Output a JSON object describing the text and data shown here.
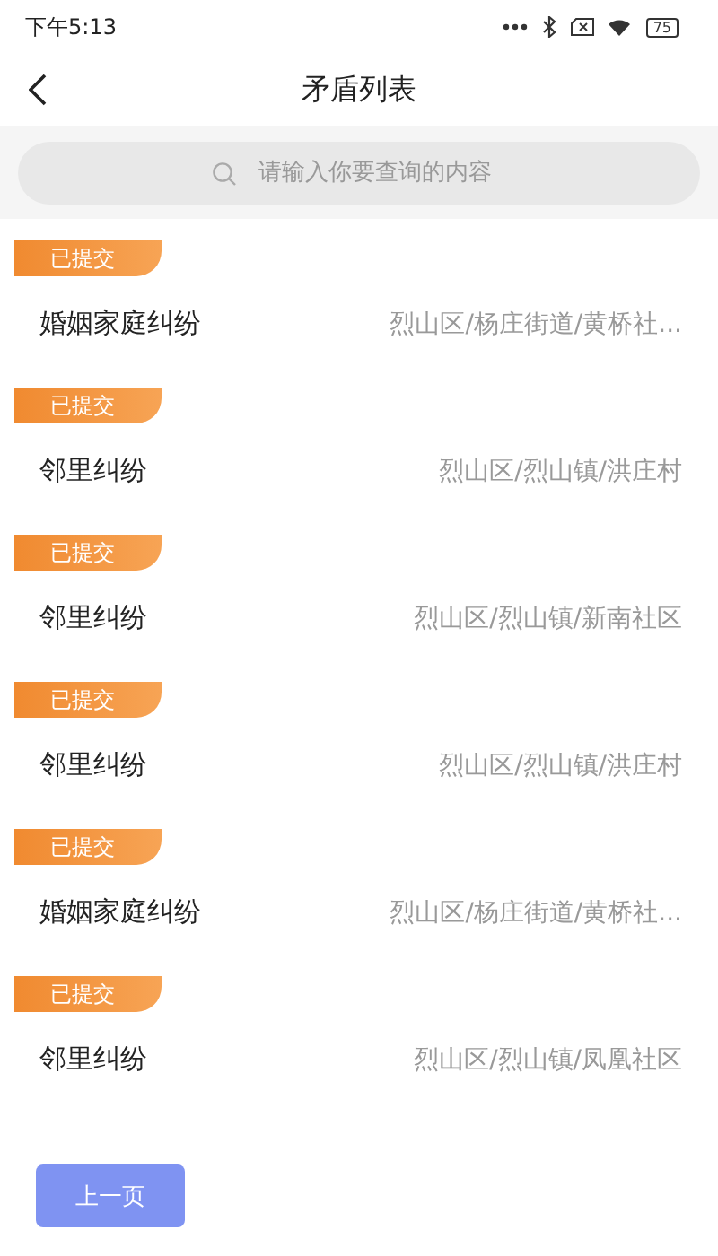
{
  "status_bar": {
    "time": "下午5:13",
    "battery": "75"
  },
  "header": {
    "title": "矛盾列表"
  },
  "search": {
    "placeholder": "请输入你要查询的内容"
  },
  "items": [
    {
      "status": "已提交",
      "title": "婚姻家庭纠纷",
      "location": "烈山区/杨庄街道/黄桥社..."
    },
    {
      "status": "已提交",
      "title": "邻里纠纷",
      "location": "烈山区/烈山镇/洪庄村"
    },
    {
      "status": "已提交",
      "title": "邻里纠纷",
      "location": "烈山区/烈山镇/新南社区"
    },
    {
      "status": "已提交",
      "title": "邻里纠纷",
      "location": "烈山区/烈山镇/洪庄村"
    },
    {
      "status": "已提交",
      "title": "婚姻家庭纠纷",
      "location": "烈山区/杨庄街道/黄桥社..."
    },
    {
      "status": "已提交",
      "title": "邻里纠纷",
      "location": "烈山区/烈山镇/凤凰社区"
    }
  ],
  "pager": {
    "prev": {
      "label": "上一页",
      "disabled": true
    }
  }
}
